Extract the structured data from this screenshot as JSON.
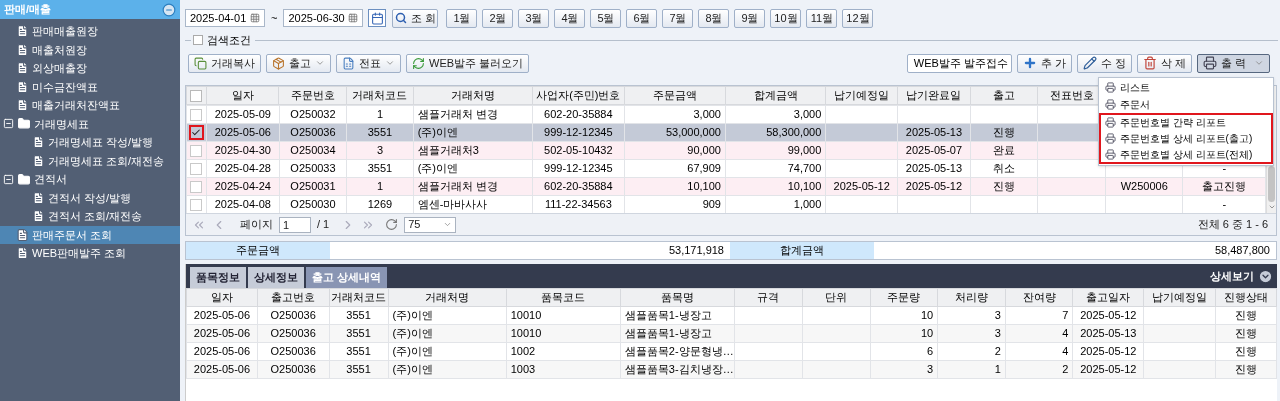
{
  "sidebar": {
    "title": "판매/매출",
    "expanded": true,
    "items": [
      {
        "label": "판매매출원장",
        "selected": false
      },
      {
        "label": "매출처원장",
        "selected": false
      },
      {
        "label": "외상매출장",
        "selected": false
      },
      {
        "label": "미수금잔액표",
        "selected": false
      },
      {
        "label": "매출거래처잔액표",
        "selected": false
      },
      {
        "label": "거래명세표",
        "selected": false,
        "expanded": true,
        "children": [
          {
            "label": "거래명세표 작성/발행",
            "selected": false
          },
          {
            "label": "거래명세표 조회/재전송",
            "selected": false
          }
        ]
      },
      {
        "label": "견적서",
        "selected": false,
        "expanded": true,
        "children": [
          {
            "label": "견적서 작성/발행",
            "selected": false
          },
          {
            "label": "견적서 조회/재전송",
            "selected": false
          }
        ]
      },
      {
        "label": "판매주문서 조회",
        "selected": true
      },
      {
        "label": "WEB판매발주 조회",
        "selected": false
      }
    ]
  },
  "search": {
    "date_from": "2025-04-01",
    "separator": "~",
    "date_to": "2025-06-30",
    "search_button": "조 회",
    "months": [
      "1월",
      "2월",
      "3월",
      "4월",
      "5월",
      "6월",
      "7월",
      "8월",
      "9월",
      "10월",
      "11월",
      "12월"
    ],
    "conditions": {
      "label": "검색조건",
      "checked": false
    }
  },
  "toolbar": {
    "left_buttons": [
      {
        "label": "거래복사",
        "kind": "copy",
        "dropdown": false
      },
      {
        "label": "출고",
        "kind": "ship",
        "dropdown": true
      },
      {
        "label": "전표",
        "kind": "slip",
        "dropdown": true
      },
      {
        "label": "WEB발주 불러오기",
        "kind": "web",
        "dropdown": false
      }
    ],
    "order_select": "WEB발주 발주접수",
    "right_buttons": [
      {
        "label": "추 가",
        "kind": "add",
        "pressed": false
      },
      {
        "label": "수 정",
        "kind": "edit",
        "pressed": false
      },
      {
        "label": "삭 제",
        "kind": "delete",
        "pressed": false
      },
      {
        "label": "출 력",
        "kind": "print",
        "pressed": true,
        "dropdown": true
      }
    ]
  },
  "print_menu": {
    "items": [
      {
        "label": "리스트",
        "highlighted": false
      },
      {
        "label": "주문서",
        "highlighted": false
      },
      {
        "label": "주문번호별 간략 리포트",
        "highlighted": true
      },
      {
        "label": "주문번호별 상세 리포트(출고)",
        "highlighted": true
      },
      {
        "label": "주문번호별 상세 리포트(전체)",
        "highlighted": true
      }
    ]
  },
  "orders": {
    "all_checked": false,
    "columns": [
      "일자",
      "주문번호",
      "거래처코드",
      "거래처명",
      "사업자(주민)번호",
      "주문금액",
      "합계금액",
      "납기예정일",
      "납기완료일",
      "출고",
      "전표번호"
    ],
    "rows": [
      {
        "date": "2025-05-09",
        "order_no": "O250032",
        "client_code": "1",
        "client_name": "샘플거래처 변경",
        "business_no": "602-20-35884",
        "order_amount": "3,000",
        "total_amount": "3,000",
        "checked": false,
        "selected": false,
        "highlighted": false,
        "marked": false
      },
      {
        "date": "2025-05-06",
        "order_no": "O250036",
        "client_code": "3551",
        "client_name": "(주)이엔",
        "business_no": "999-12-12345",
        "order_amount": "53,000,000",
        "total_amount": "58,300,000",
        "done_date": "2025-05-13",
        "shipment": "진행",
        "checked": true,
        "selected": true,
        "highlighted": false,
        "marked": true
      },
      {
        "date": "2025-04-30",
        "order_no": "O250034",
        "client_code": "3",
        "client_name": "샘플거래처3",
        "business_no": "502-05-10432",
        "order_amount": "90,000",
        "total_amount": "99,000",
        "done_date": "2025-05-07",
        "shipment": "완료",
        "checked": false,
        "selected": false,
        "highlighted": true,
        "marked": false
      },
      {
        "date": "2025-04-28",
        "order_no": "O250033",
        "client_code": "3551",
        "client_name": "(주)이엔",
        "business_no": "999-12-12345",
        "order_amount": "67,909",
        "total_amount": "74,700",
        "done_date": "2025-05-13",
        "shipment": "취소",
        "column_13": "-",
        "checked": false,
        "selected": false,
        "highlighted": false,
        "marked": false
      },
      {
        "date": "2025-04-24",
        "order_no": "O250031",
        "client_code": "1",
        "client_name": "샘플거래처 변경",
        "business_no": "602-20-35884",
        "order_amount": "10,100",
        "total_amount": "10,100",
        "due_date": "2025-05-12",
        "done_date": "2025-05-12",
        "shipment": "진행",
        "column_12": "W250006",
        "column_13": "출고진행",
        "checked": false,
        "selected": false,
        "highlighted": true,
        "marked": false
      },
      {
        "date": "2025-04-08",
        "order_no": "O250030",
        "client_code": "1269",
        "client_name": "엠센-마바사사",
        "business_no": "111-22-34563",
        "order_amount": "909",
        "total_amount": "1,000",
        "column_13": "-",
        "checked": false,
        "selected": false,
        "highlighted": false,
        "marked": false
      }
    ]
  },
  "pager": {
    "page_label": "페이지",
    "page": "1",
    "page_count": "/ 1",
    "page_size": "75",
    "summary": "전체 6 중 1 - 6"
  },
  "totals": {
    "order_amount_label": "주문금액",
    "order_amount": "53,171,918",
    "total_label": "합계금액",
    "total": "58,487,800"
  },
  "detail": {
    "tabs": [
      {
        "label": "품목정보",
        "selected": false
      },
      {
        "label": "상세정보",
        "selected": false
      },
      {
        "label": "출고 상세내역",
        "selected": true
      }
    ],
    "toggle": "상세보기",
    "columns": [
      "일자",
      "출고번호",
      "거래처코드",
      "거래처명",
      "품목코드",
      "품목명",
      "규격",
      "단위",
      "주문량",
      "처리량",
      "잔여량",
      "출고일자",
      "납기예정일",
      "진행상태"
    ],
    "rows": [
      {
        "date": "2025-05-06",
        "ship_no": "O250036",
        "client_code": "3551",
        "client_name": "(주)이엔",
        "item_code": "10010",
        "item_name": "샘플품목1-냉장고",
        "ordered": "10",
        "processed": "3",
        "remaining": "7",
        "ship_date": "2025-05-12",
        "status": "진행"
      },
      {
        "date": "2025-05-06",
        "ship_no": "O250036",
        "client_code": "3551",
        "client_name": "(주)이엔",
        "item_code": "10010",
        "item_name": "샘플품목1-냉장고",
        "ordered": "10",
        "processed": "3",
        "remaining": "4",
        "ship_date": "2025-05-13",
        "status": "진행"
      },
      {
        "date": "2025-05-06",
        "ship_no": "O250036",
        "client_code": "3551",
        "client_name": "(주)이엔",
        "item_code": "1002",
        "item_name": "샘플품목2-양문형냉…",
        "ordered": "6",
        "processed": "2",
        "remaining": "4",
        "ship_date": "2025-05-12",
        "status": "진행"
      },
      {
        "date": "2025-05-06",
        "ship_no": "O250036",
        "client_code": "3551",
        "client_name": "(주)이엔",
        "item_code": "1003",
        "item_name": "샘플품목3-김치냉장…",
        "ordered": "3",
        "processed": "1",
        "remaining": "2",
        "ship_date": "2025-05-12",
        "status": "진행"
      }
    ]
  }
}
